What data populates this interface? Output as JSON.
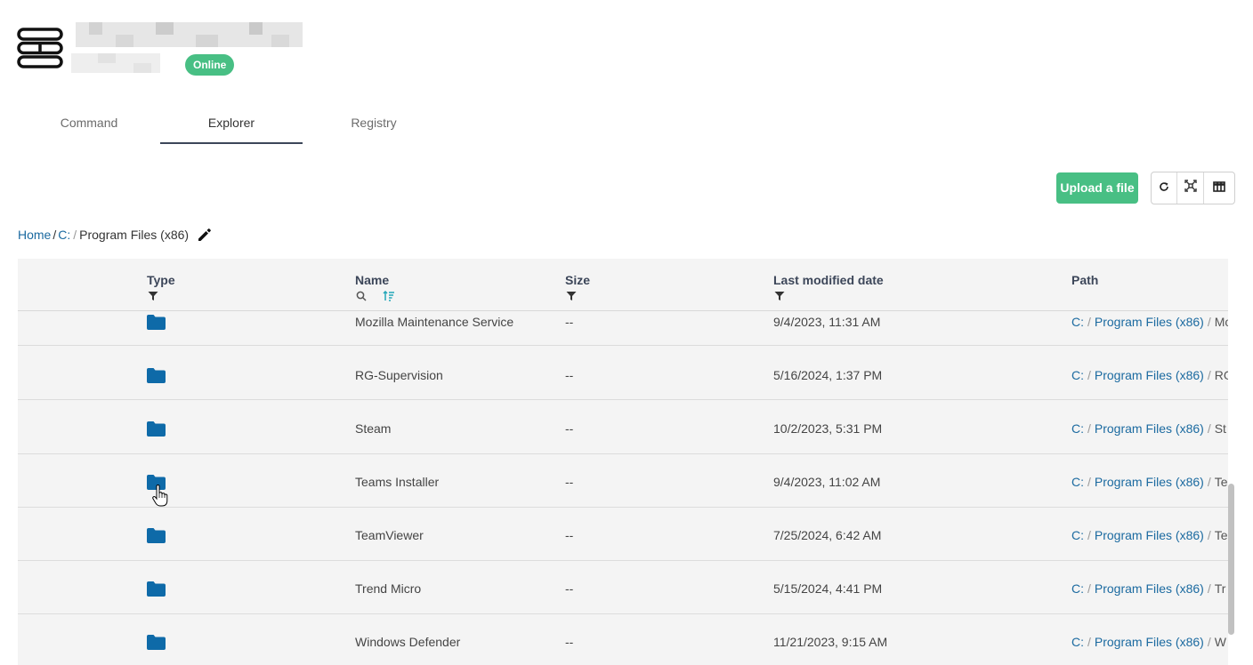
{
  "device": {
    "status": "Online"
  },
  "tabs": [
    {
      "label": "Command",
      "active": false
    },
    {
      "label": "Explorer",
      "active": true
    },
    {
      "label": "Registry",
      "active": false
    }
  ],
  "toolbar": {
    "upload_label": "Upload a file"
  },
  "breadcrumb": {
    "home": "Home",
    "sep": "/",
    "drive": "C:",
    "current": "Program Files (x86)"
  },
  "table": {
    "headers": {
      "type": "Type",
      "name": "Name",
      "size": "Size",
      "modified": "Last modified date",
      "path": "Path"
    },
    "rows": [
      {
        "name": "Mozilla Maintenance Service",
        "size": "--",
        "modified": "9/4/2023, 11:31 AM",
        "path_drive": "C:",
        "path_folder": "Program Files (x86)",
        "path_tail": "Mo"
      },
      {
        "name": "RG-Supervision",
        "size": "--",
        "modified": "5/16/2024, 1:37 PM",
        "path_drive": "C:",
        "path_folder": "Program Files (x86)",
        "path_tail": "RG"
      },
      {
        "name": "Steam",
        "size": "--",
        "modified": "10/2/2023, 5:31 PM",
        "path_drive": "C:",
        "path_folder": "Program Files (x86)",
        "path_tail": "St"
      },
      {
        "name": "Teams Installer",
        "size": "--",
        "modified": "9/4/2023, 11:02 AM",
        "path_drive": "C:",
        "path_folder": "Program Files (x86)",
        "path_tail": "Te"
      },
      {
        "name": "TeamViewer",
        "size": "--",
        "modified": "7/25/2024, 6:42 AM",
        "path_drive": "C:",
        "path_folder": "Program Files (x86)",
        "path_tail": "Te"
      },
      {
        "name": "Trend Micro",
        "size": "--",
        "modified": "5/15/2024, 4:41 PM",
        "path_drive": "C:",
        "path_folder": "Program Files (x86)",
        "path_tail": "Tr"
      },
      {
        "name": "Windows Defender",
        "size": "--",
        "modified": "11/21/2023, 9:15 AM",
        "path_drive": "C:",
        "path_folder": "Program Files (x86)",
        "path_tail": "W"
      }
    ]
  },
  "colors": {
    "accent": "#48bf84",
    "link": "#1b6aa0",
    "folder": "#0e6aa8",
    "header_text": "#3c4659"
  },
  "icons": [
    "server-icon",
    "refresh-icon",
    "fullscreen-icon",
    "columns-icon",
    "pencil-icon",
    "filter-icon",
    "search-icon",
    "sort-icon",
    "folder-icon",
    "hand-cursor-icon"
  ]
}
